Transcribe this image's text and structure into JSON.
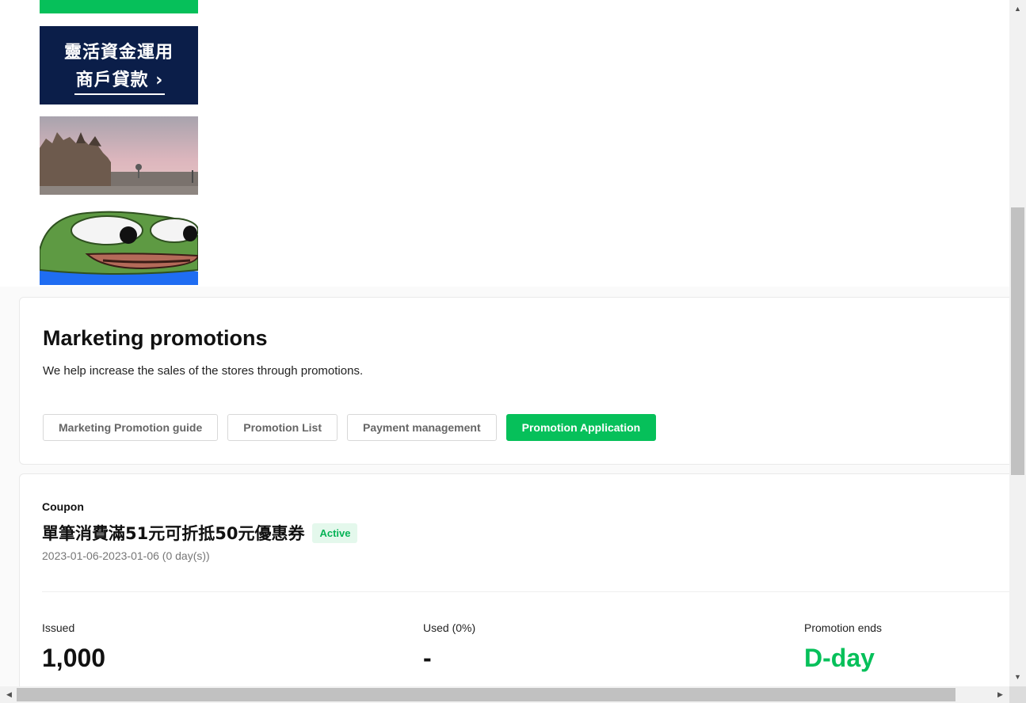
{
  "banners": {
    "loan_line1": "靈活資金運用",
    "loan_line2": "商戶貸款 ›"
  },
  "header": {
    "title": "Marketing promotions",
    "description": "We help increase the sales of the stores through promotions.",
    "tabs": [
      {
        "label": "Marketing Promotion guide"
      },
      {
        "label": "Promotion List"
      },
      {
        "label": "Payment management"
      },
      {
        "label": "Promotion Application",
        "active": true
      }
    ]
  },
  "coupon": {
    "type": "Coupon",
    "title": "單筆消費滿51元可折抵50元優惠券",
    "status": "Active",
    "date_range": "2023-01-06-2023-01-06 (0 day(s))",
    "stats": {
      "issued_label": "Issued",
      "issued_value": "1,000",
      "used_label": "Used (0%)",
      "used_value": "-",
      "ends_label": "Promotion ends",
      "ends_value": "D-day"
    }
  },
  "colors": {
    "brand_green": "#06c05a",
    "navy": "#0b1e49"
  }
}
